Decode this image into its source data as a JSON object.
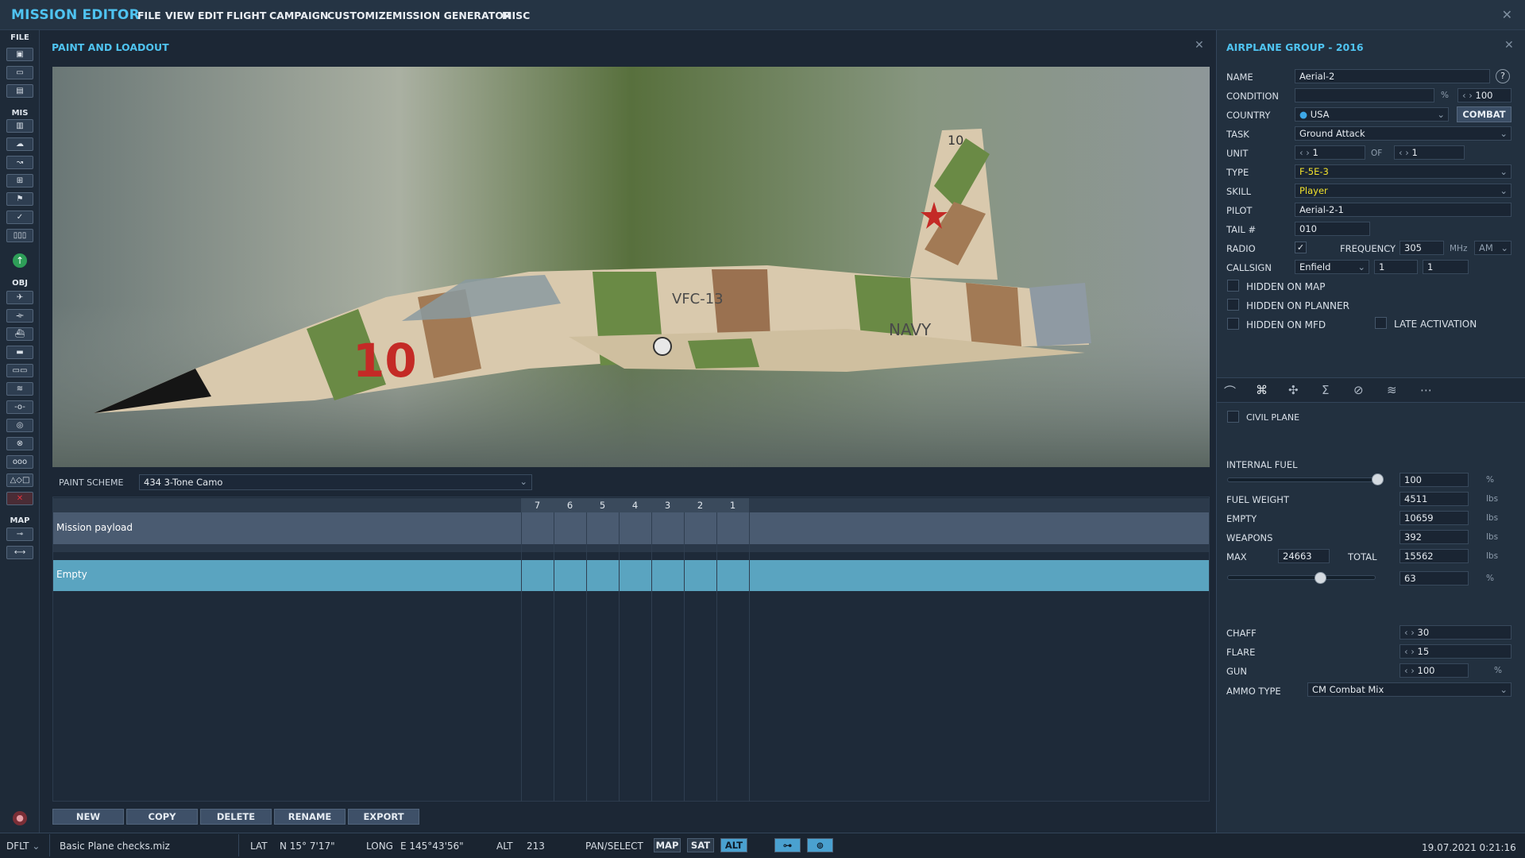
{
  "app": {
    "title": "MISSION EDITOR",
    "menu": [
      "FILE",
      "VIEW",
      "EDIT",
      "FLIGHT",
      "CAMPAIGN",
      "CUSTOMIZE",
      "MISSION GENERATOR",
      "MISC"
    ]
  },
  "toolbar": {
    "sections": {
      "file": "FILE",
      "mis": "MIS",
      "obj": "OBJ",
      "map": "MAP"
    }
  },
  "paint_panel": {
    "title": "PAINT AND LOADOUT",
    "paint_scheme_label": "PAINT SCHEME",
    "paint_scheme_value": "434 3-Tone Camo",
    "aircraft_markings": {
      "tail": "10",
      "nose": "10",
      "fuselage": "VFC-13",
      "navy": "NAVY"
    },
    "stations": [
      "7",
      "6",
      "5",
      "4",
      "3",
      "2",
      "1"
    ],
    "rows": [
      {
        "label": "Mission payload"
      },
      {
        "label": "Empty"
      }
    ],
    "buttons": {
      "new": "NEW",
      "copy": "COPY",
      "delete": "DELETE",
      "rename": "RENAME",
      "export": "EXPORT"
    }
  },
  "group": {
    "title": "AIRPLANE GROUP - 2016",
    "name_label": "NAME",
    "name_value": "Aerial-2",
    "help": "?",
    "condition_label": "CONDITION",
    "condition_unit": "%",
    "condition_value": "100",
    "country_label": "COUNTRY",
    "country_value": "USA",
    "combat_btn": "COMBAT",
    "task_label": "TASK",
    "task_value": "Ground Attack",
    "unit_label": "UNIT",
    "unit_value": "1",
    "of_label": "OF",
    "of_value": "1",
    "type_label": "TYPE",
    "type_value": "F-5E-3",
    "skill_label": "SKILL",
    "skill_value": "Player",
    "pilot_label": "PILOT",
    "pilot_value": "Aerial-2-1",
    "tail_label": "TAIL #",
    "tail_value": "010",
    "radio_label": "RADIO",
    "frequency_label": "FREQUENCY",
    "frequency_value": "305",
    "mhz": "MHz",
    "modulation": "AM",
    "callsign_label": "CALLSIGN",
    "callsign_value": "Enfield",
    "callsign_n1": "1",
    "callsign_n2": "1",
    "hidden_map": "HIDDEN ON MAP",
    "hidden_planner": "HIDDEN ON PLANNER",
    "hidden_mfd": "HIDDEN ON MFD",
    "late_activation": "LATE ACTIVATION",
    "radio_checked": true
  },
  "payload": {
    "tabs": [
      "route-icon",
      "payload-icon",
      "drone-icon",
      "summary-icon",
      "forbid-icon",
      "radio-icon",
      "more-icon"
    ],
    "civil_plane": "CIVIL PLANE",
    "internal_fuel_label": "INTERNAL FUEL",
    "internal_fuel_value": "100",
    "pct": "%",
    "fuel_weight_label": "FUEL WEIGHT",
    "fuel_weight_value": "4511",
    "empty_label": "EMPTY",
    "empty_value": "10659",
    "weapons_label": "WEAPONS",
    "weapons_value": "392",
    "max_label": "MAX",
    "max_value": "24663",
    "total_label": "TOTAL",
    "total_value": "15562",
    "load_pct": "63",
    "lbs": "lbs",
    "internal_fuel_fraction": 1.0,
    "load_fraction": 0.63,
    "chaff_label": "CHAFF",
    "chaff_value": "30",
    "flare_label": "FLARE",
    "flare_value": "15",
    "gun_label": "GUN",
    "gun_value": "100",
    "ammo_label": "AMMO TYPE",
    "ammo_value": "CM Combat Mix"
  },
  "status": {
    "profile": "DFLT",
    "file": "Basic Plane checks.miz",
    "lat_label": "LAT",
    "lat_value": "N 15° 7'17\"",
    "long_label": "LONG",
    "long_value": "E 145°43'56\"",
    "alt_label": "ALT",
    "alt_value": "213",
    "mode": "PAN/SELECT",
    "map": "MAP",
    "sat": "SAT",
    "alt_btn": "ALT",
    "datetime": "19.07.2021 0:21:16"
  }
}
